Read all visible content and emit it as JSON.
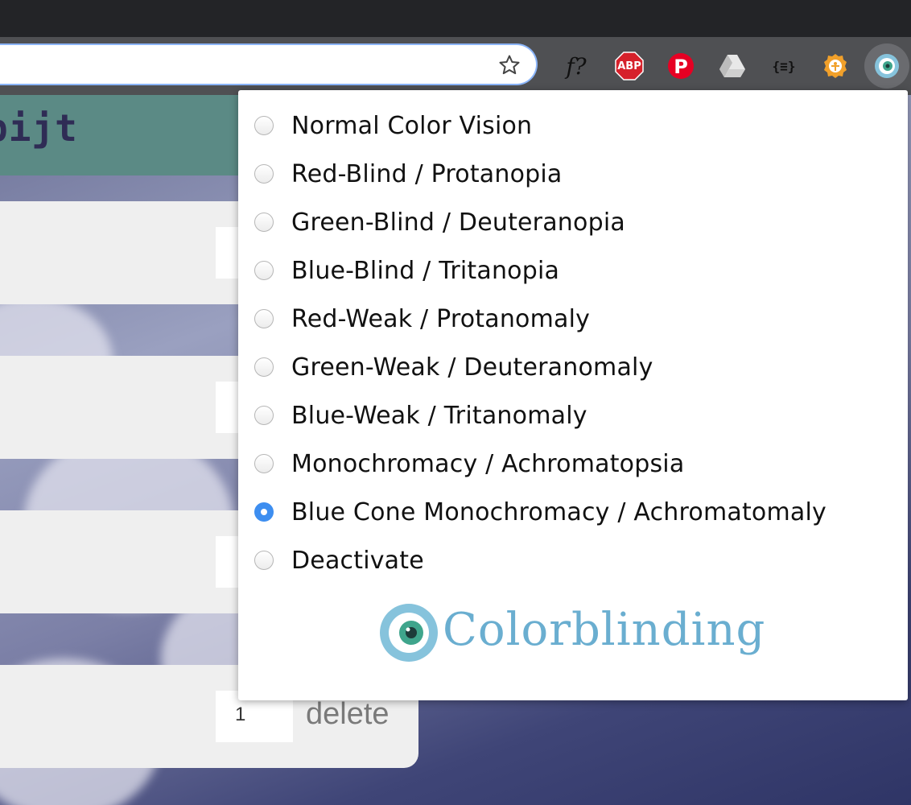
{
  "browser": {
    "extensions": [
      {
        "name": "fontface-icon",
        "label": "f?"
      },
      {
        "name": "adblock-icon",
        "label": "ABP"
      },
      {
        "name": "pinterest-icon",
        "label": "P"
      },
      {
        "name": "drive-icon",
        "label": ""
      },
      {
        "name": "json-viewer-icon",
        "label": "{≡}"
      },
      {
        "name": "accessibility-icon",
        "label": ""
      },
      {
        "name": "colorblinding-icon",
        "label": ""
      }
    ]
  },
  "page": {
    "header_title": "bijt",
    "rows": [
      {
        "qty": "",
        "delete": ""
      },
      {
        "qty": "",
        "delete": ""
      },
      {
        "qty": "",
        "delete": ""
      },
      {
        "qty": "1",
        "delete": "delete"
      }
    ]
  },
  "popup": {
    "options": [
      {
        "label": "Normal Color Vision",
        "selected": false
      },
      {
        "label": "Red-Blind / Protanopia",
        "selected": false
      },
      {
        "label": "Green-Blind / Deuteranopia",
        "selected": false
      },
      {
        "label": "Blue-Blind / Tritanopia",
        "selected": false
      },
      {
        "label": "Red-Weak / Protanomaly",
        "selected": false
      },
      {
        "label": "Green-Weak / Deuteranomaly",
        "selected": false
      },
      {
        "label": "Blue-Weak / Tritanomaly",
        "selected": false
      },
      {
        "label": "Monochromacy / Achromatopsia",
        "selected": false
      },
      {
        "label": "Blue Cone Monochromacy / Achromatomaly",
        "selected": true
      },
      {
        "label": "Deactivate",
        "selected": false
      }
    ],
    "logo_text": "Colorblinding"
  },
  "colors": {
    "selected_radio": "#3d8ef0",
    "logo": "#6aaed0",
    "header": "#5b8a85"
  }
}
